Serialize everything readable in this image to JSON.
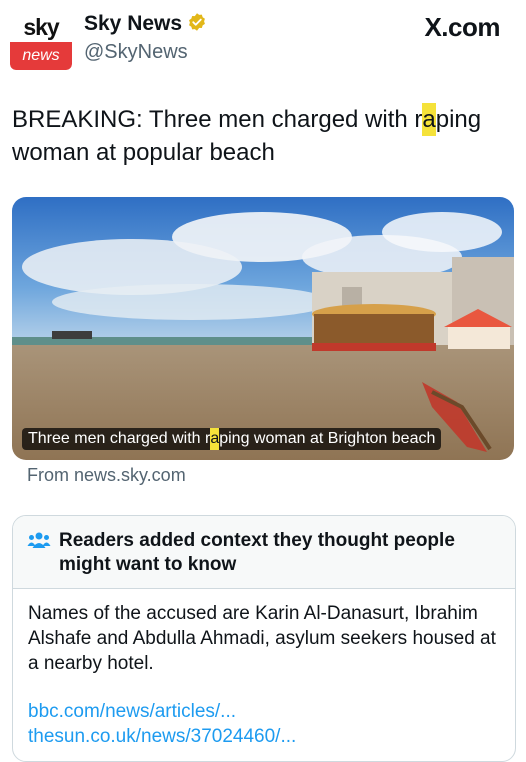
{
  "account": {
    "logo_top": "sky",
    "logo_bottom": "news",
    "name": "Sky News",
    "handle": "@SkyNews",
    "site_badge": "X.com"
  },
  "post": {
    "headline_part1": "BREAKING: Three men charged with r",
    "headline_censor": "a",
    "headline_part2": "ping woman at popular beach"
  },
  "card": {
    "caption_part1": "Three men charged with r",
    "caption_censor": "a",
    "caption_part2": "ping woman at Brighton beach",
    "source": "From news.sky.com"
  },
  "community_note": {
    "title": "Readers added context they thought people might want to know",
    "body": "Names of the accused are Karin Al-Danasurt, Ibrahim Alshafe and Abdulla Ahmadi, asylum seekers housed at a nearby hotel.",
    "links": [
      "bbc.com/news/articles/...",
      "thesun.co.uk/news/37024460/..."
    ]
  },
  "colors": {
    "brand_red": "#e53a3a",
    "link_blue": "#1d9bf0",
    "verified_gold": "#e2b719",
    "censor_yellow": "#f5e23a"
  },
  "icons": [
    "verified-badge-icon",
    "people-icon"
  ]
}
